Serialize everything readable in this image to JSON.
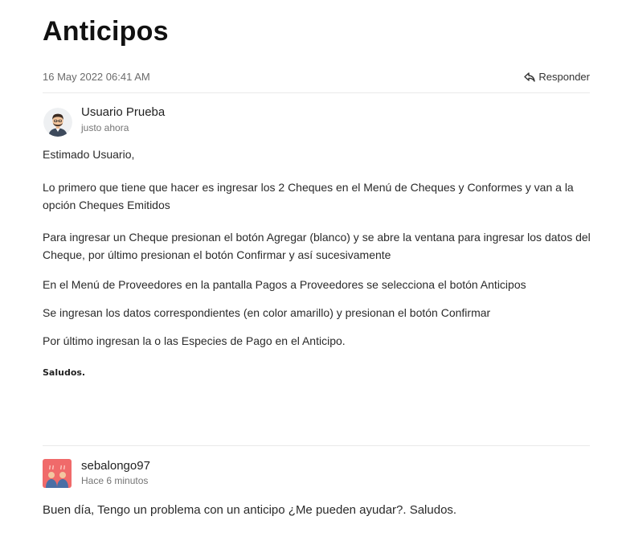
{
  "page": {
    "title": "Anticipos"
  },
  "ticket": {
    "date": "16 May 2022 06:41 AM",
    "reply_label": "Responder"
  },
  "response": {
    "author": "Usuario Prueba",
    "time": "justo ahora",
    "greeting": "Estimado Usuario,",
    "paragraphs": [
      "Lo primero que tiene que hacer es ingresar los 2 Cheques en el Menú de Cheques y Conformes y van a la opción Cheques Emitidos",
      "Para ingresar un Cheque presionan el botón Agregar (blanco) y se abre la ventana para ingresar los datos del Cheque, por último presionan el botón Confirmar y así sucesivamente",
      "En el Menú de Proveedores en la pantalla Pagos a Proveedores se selecciona el botón Anticipos",
      "Se ingresan los datos correspondientes (en color amarillo) y presionan el botón Confirmar",
      "Por último ingresan la o las Especies de Pago en el Anticipo."
    ],
    "signoff": "Saludos."
  },
  "question": {
    "author": "sebalongo97",
    "time": "Hace 6 minutos",
    "text": "Buen día, Tengo un problema con un anticipo ¿Me pueden ayudar?. Saludos."
  },
  "icons": {
    "reply": "reply-arrow-icon"
  },
  "colors": {
    "avatar_bg_question": "#f06a6a",
    "divider": "#e9e9e9"
  }
}
